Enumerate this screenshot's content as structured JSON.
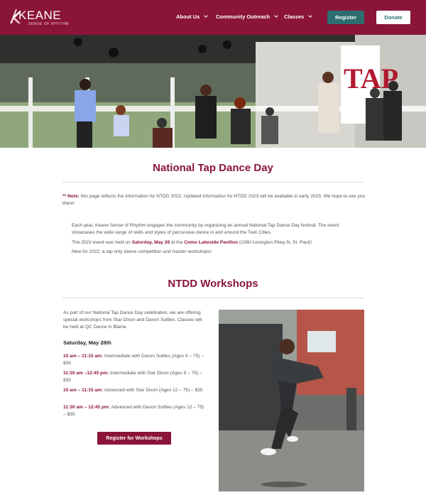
{
  "brand": {
    "name": "KEANE",
    "tagline": "SENSE OF RHYTHM"
  },
  "nav": {
    "items": [
      {
        "label": "About Us"
      },
      {
        "label": "Community Outreach"
      },
      {
        "label": "Classes"
      }
    ],
    "register_label": "Register",
    "donate_label": "Donate"
  },
  "colors": {
    "primary": "#8a1538",
    "teal": "#2c6e6f"
  },
  "page": {
    "title": "National Tap Dance Day",
    "note_label": "** Note:",
    "note_text": " this page reflects the information for NTDD 2022. Updated information for NTDD 2023 will be available in early 2023. We hope to see you there!",
    "intro_p1": "Each year, Keane Sense of Rhythm engages the community by organizing an annual National Tap Dance Day festival. The event showcases the wide range of skills and styles of percussive dance in and around the Twin Cities.",
    "intro_p2_a": "The 2022 event was held on ",
    "intro_p2_date": "Saturday, May 28",
    "intro_p2_b": " at the ",
    "intro_p2_venue": "Como Lakeside Pavilion",
    "intro_p2_c": " (1360 Lexington Pkwy N, St. Paul)!",
    "intro_p3": "New for 2022: a tap only dance competition and master workshops!"
  },
  "workshops": {
    "title": "NTDD Workshops",
    "intro": "As part of our National Tap Dance Day celebration, we are offering special workshops from Star Dixon and Davon Suttles.  Classes will be held at QC Dance in Blaine.",
    "date": "Saturday, May 28th",
    "items": [
      {
        "time": "10 am – 11:15 am:",
        "desc": " Intermediate with Davon Suttles (Ages 9 – 75) – $35"
      },
      {
        "time": "11:30 am –12:45 pm:",
        "desc": " Intermediate with Star Dixon (Ages 9 – 75) – $35"
      },
      {
        "time": "10 am – 11:15 am:",
        "desc": " Advanced with Star Dixon (Ages 12 – 75) – $35"
      },
      {
        "time": "11:30 am – 12:45 pm:",
        "desc": " Advanced with Davon Suttles (Ages 12 – 75) – $35"
      }
    ],
    "register_label": "Register for Workshops"
  }
}
